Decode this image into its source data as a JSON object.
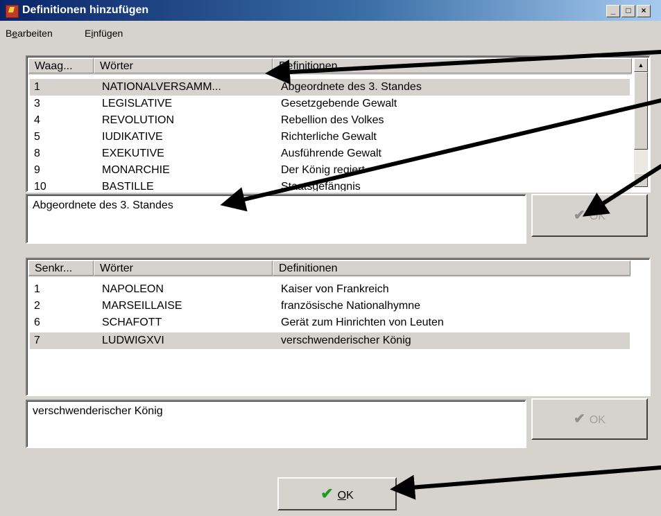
{
  "window": {
    "title": "Definitionen hinzufügen"
  },
  "caption_buttons": {
    "minimize": "_",
    "maximize": "□",
    "close": "×"
  },
  "menu": {
    "items": [
      {
        "label_pre": "B",
        "label_ul": "e",
        "label_post": "arbeiten"
      },
      {
        "label_pre": "E",
        "label_ul": "i",
        "label_post": "nfügen"
      }
    ]
  },
  "top_list": {
    "headers": [
      "Waag...",
      "Wörter",
      "Definitionen"
    ],
    "rows": [
      {
        "num": "1",
        "word": "NATIONALVERSAMM...",
        "def": "Abgeordnete des 3. Standes",
        "selected": true
      },
      {
        "num": "3",
        "word": "LEGISLATIVE",
        "def": "Gesetzgebende Gewalt"
      },
      {
        "num": "4",
        "word": "REVOLUTION",
        "def": "Rebellion des Volkes"
      },
      {
        "num": "5",
        "word": "IUDIKATIVE",
        "def": "Richterliche Gewalt"
      },
      {
        "num": "8",
        "word": "EXEKUTIVE",
        "def": "Ausführende Gewalt"
      },
      {
        "num": "9",
        "word": "MONARCHIE",
        "def": "Der König regiert"
      },
      {
        "num": "10",
        "word": "BASTILLE",
        "def": "Staatsgefängnis"
      }
    ]
  },
  "top_memo": {
    "text": "Abgeordnete des 3. Standes"
  },
  "top_ok": {
    "label": "OK"
  },
  "bottom_list": {
    "headers": [
      "Senkr...",
      "Wörter",
      "Definitionen"
    ],
    "rows": [
      {
        "num": "1",
        "word": "NAPOLEON",
        "def": "Kaiser von Frankreich"
      },
      {
        "num": "2",
        "word": "MARSEILLAISE",
        "def": "französische Nationalhymne"
      },
      {
        "num": "6",
        "word": "SCHAFOTT",
        "def": "Gerät zum Hinrichten von Leuten"
      },
      {
        "num": "7",
        "word": "LUDWIGXVI",
        "def": "verschwenderischer König",
        "selected": true
      }
    ]
  },
  "bottom_memo": {
    "text": "verschwenderischer König"
  },
  "bottom_ok": {
    "label": "OK"
  },
  "main_ok": {
    "label_ul": "O",
    "label_post": "K"
  },
  "icons": {
    "check": "✔"
  },
  "colors": {
    "title_start": "#0a246a",
    "title_end": "#a6caf0",
    "check_green": "#1e9b1e",
    "face": "#d6d3ce"
  }
}
